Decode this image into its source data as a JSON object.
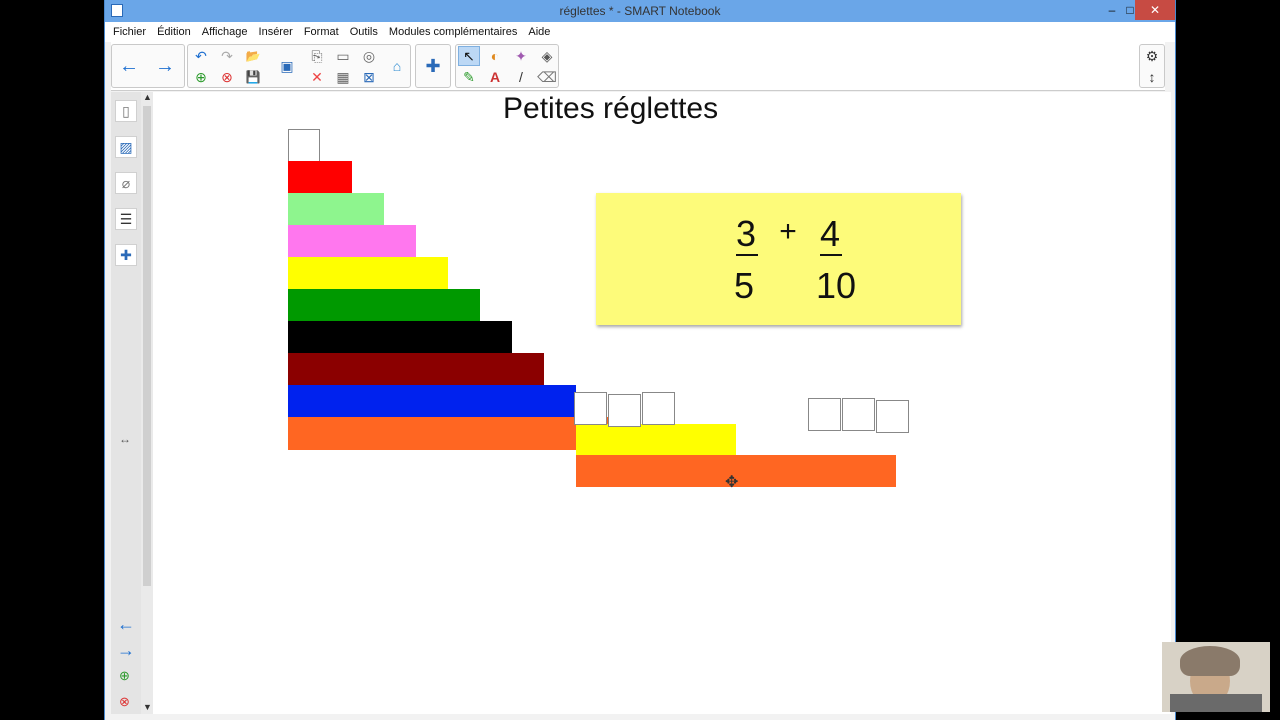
{
  "window": {
    "title": "réglettes * - SMART Notebook",
    "minimize": "–",
    "maximize": "□",
    "close": "✕"
  },
  "menu": [
    "Fichier",
    "Édition",
    "Affichage",
    "Insérer",
    "Format",
    "Outils",
    "Modules complémentaires",
    "Aide"
  ],
  "page": {
    "title": "Petites réglettes",
    "fraction_left": {
      "numerator": "3",
      "denominator": "5"
    },
    "operator": "+",
    "fraction_right": {
      "numerator": "4",
      "denominator": "10"
    }
  },
  "rods": [
    {
      "length": 1,
      "color": "#ffffff"
    },
    {
      "length": 2,
      "color": "#ff0000"
    },
    {
      "length": 3,
      "color": "#8ef58e"
    },
    {
      "length": 4,
      "color": "#ff77ee"
    },
    {
      "length": 5,
      "color": "#ffff00"
    },
    {
      "length": 6,
      "color": "#009900"
    },
    {
      "length": 7,
      "color": "#000000"
    },
    {
      "length": 8,
      "color": "#8b0000"
    },
    {
      "length": 9,
      "color": "#0022ee"
    },
    {
      "length": 10,
      "color": "#ff6622"
    }
  ],
  "workspace": {
    "yellow_rod": {
      "length": 5,
      "color": "#ffff00"
    },
    "orange_rod": {
      "length": 10,
      "color": "#ff6622"
    },
    "left_squares": 3,
    "right_squares": 3
  },
  "icons": {
    "back": "←",
    "forward": "→",
    "undo": "↶",
    "redo": "↷",
    "open": "📂",
    "save": "💾",
    "delete": "✕",
    "table": "▦",
    "select": "↖",
    "pen": "✎",
    "text": "A",
    "line": "/",
    "eraser": "⌫",
    "settings": "⚙",
    "move_toolbar": "↕",
    "move_cursor": "✥"
  }
}
